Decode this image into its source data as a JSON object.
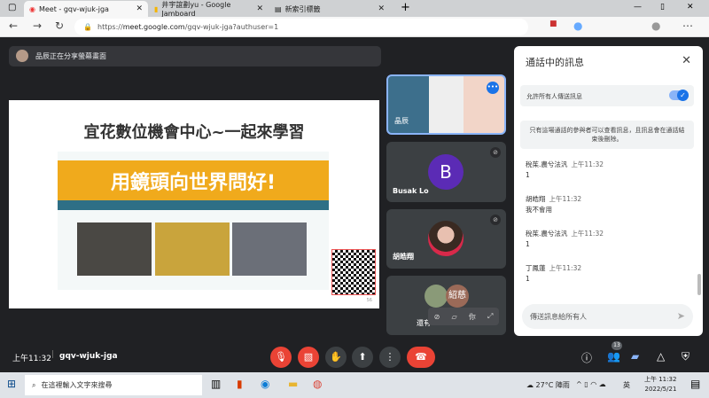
{
  "browser": {
    "tabs": [
      {
        "label": "Meet - gqv-wjuk-jga",
        "active": true
      },
      {
        "label": "井宇誼劃yu - Google Jamboard",
        "active": false
      },
      {
        "label": "新索引標籤",
        "active": false
      }
    ],
    "url_prefix": "https://",
    "url_host": "meet.google.com",
    "url_path": "/gqv-wjuk-jga?authuser=1"
  },
  "meet": {
    "share_banner": "品辰正在分享螢幕畫面",
    "slide": {
      "title": "宜花數位機會中心~一起來學習",
      "banner": "用鏡頭向世界問好!",
      "page": "56"
    },
    "tiles": [
      {
        "name": "晶辰",
        "speaking": true
      },
      {
        "name": "Busak Lo",
        "initial": "B",
        "avatar_color": "#5b2bb5",
        "muted": true
      },
      {
        "name": "胡皓翔",
        "muted": true
      },
      {
        "name": "還有",
        "extra": "紹慈",
        "self_label": "你"
      }
    ],
    "chat": {
      "title": "通話中的訊息",
      "allow_label": "允許所有人傳送訊息",
      "allow_enabled": true,
      "notice": "只有這場通話的參與者可以查看訊息，且訊息會在通話結束後刪除。",
      "messages": [
        {
          "sender": "稅茱.農兮法汎",
          "time": "上午11:32",
          "text": "1"
        },
        {
          "sender": "胡皓翔",
          "time": "上午11:32",
          "text": "我不會用"
        },
        {
          "sender": "稅茱.農兮法汎",
          "time": "上午11:32",
          "text": "1"
        },
        {
          "sender": "丁鳳蓮",
          "time": "上午11:32",
          "text": "1"
        }
      ],
      "input_placeholder": "傳送訊息給所有人"
    },
    "bottom": {
      "time": "上午11:32",
      "code": "gqv-wjuk-jga",
      "participants_count": "13"
    }
  },
  "taskbar": {
    "search_placeholder": "在這裡輸入文字來搜尋",
    "weather": "27°C 陣雨",
    "ime": "英",
    "time": "上午 11:32",
    "date": "2022/5/21"
  },
  "colors": {
    "accent": "#1a73e8",
    "danger": "#ea4335",
    "meet_bg": "#202124"
  }
}
